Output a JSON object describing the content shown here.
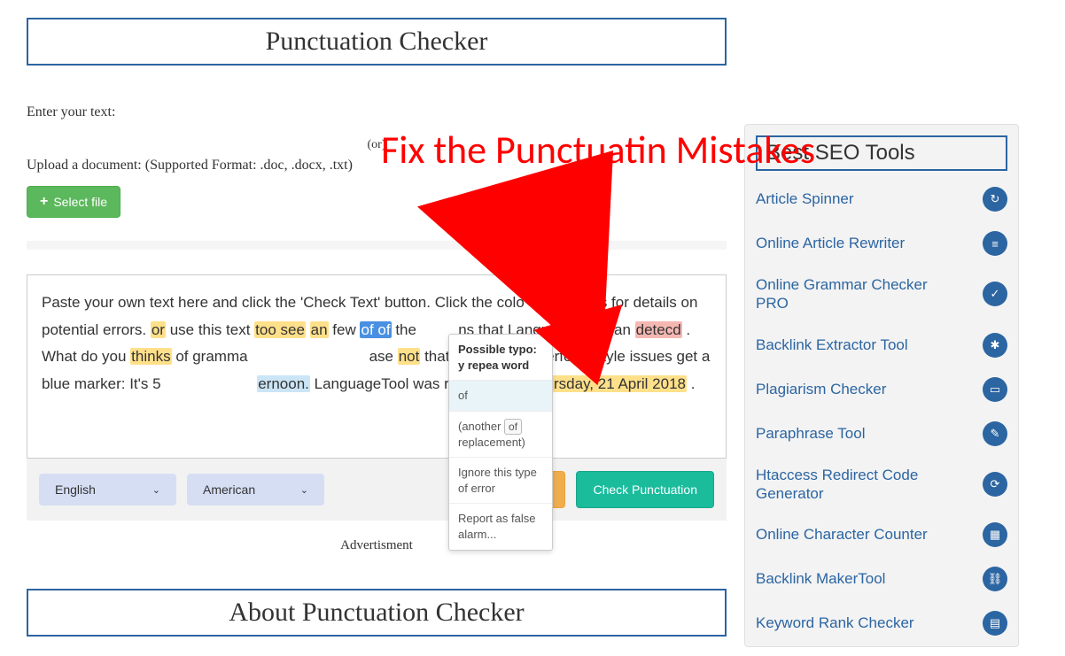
{
  "annotation": {
    "text": "Fix the Punctuatin Mistakes"
  },
  "main": {
    "title": "Punctuation Checker",
    "enter_label": "Enter your text:",
    "or_text": "(or)",
    "upload_label": "Upload a document: (Supported Format: .doc, .docx, .txt)",
    "select_file": "Select file",
    "about_title": "About Punctuation Checker",
    "advertisement_label": "Advertisment",
    "editor": {
      "segments": {
        "pre": "Paste your own text here and click the 'Check Text' button. Click the colo",
        "cut1": "phrases for details on potential errors. ",
        "or": "or",
        "cut2": " use this text ",
        "too_see": "too see",
        "sp1": " ",
        "an": "an",
        "cut3": " few ",
        "of_of": "of of",
        "cut4": " the ",
        "prob": "ns that LanguageTool can ",
        "detecd": "detecd",
        "cut5": ". What do you ",
        "thinks": "thinks",
        "cut6": " of gramma",
        "cut7": "ase ",
        "not": "not",
        "cut8": " that they are not perfect. Style issues get a blue marker: It's 5 ",
        "afternoon": "ernoon.",
        "cut9": " LanguageTool was released on ",
        "date": "Thursday, 21 April 2018",
        "dot": "."
      }
    },
    "tooltip": {
      "header": "Possible typo: y repea word",
      "suggestion": "of",
      "replacement_pre": "(another",
      "replacement_pill": "of",
      "replacement_post": "replacement)",
      "ignore": "Ignore this type of error",
      "report": "Report as false alarm..."
    },
    "controls": {
      "lang": "English",
      "variant": "American",
      "check_button": "Check Punctuation"
    }
  },
  "sidebar": {
    "title": "Best SEO Tools",
    "items": [
      {
        "label": "Article Spinner",
        "icon": "↻"
      },
      {
        "label": "Online Article Rewriter",
        "icon": "≡"
      },
      {
        "label": "Online Grammar Checker PRO",
        "icon": "✓"
      },
      {
        "label": "Backlink Extractor Tool",
        "icon": "✱"
      },
      {
        "label": "Plagiarism Checker",
        "icon": "▭"
      },
      {
        "label": "Paraphrase Tool",
        "icon": "✎"
      },
      {
        "label": "Htaccess Redirect Code Generator",
        "icon": "⟳"
      },
      {
        "label": "Online Character Counter",
        "icon": "▦"
      },
      {
        "label": "Backlink MakerTool",
        "icon": "⛓"
      },
      {
        "label": "Keyword Rank Checker",
        "icon": "▤"
      }
    ]
  }
}
